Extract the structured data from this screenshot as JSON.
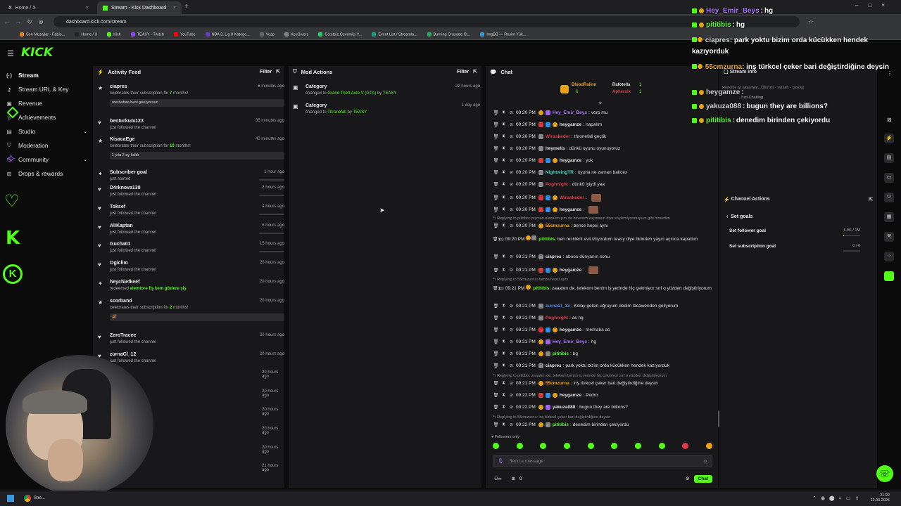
{
  "browser": {
    "tabs": [
      {
        "label": "Home / X"
      },
      {
        "label": "Stream - Kick Dashboard"
      }
    ],
    "url": "dashboard.kick.com/stream",
    "bookmarks": [
      "Son Mesajlar - Fabio...",
      "Home / X",
      "Kick",
      "TEASY - Twitch",
      "YouTube",
      "NBA 3. Lig 8 Katego...",
      "Vosp",
      "KeyGivers",
      "Ücretsiz Çevrimiçi Y...",
      "Event List / Streamla...",
      "Burning Crusade Cl...",
      "ImgBB — Resim Yük..."
    ]
  },
  "header": {
    "logo": "KICK"
  },
  "sidebar": {
    "items": [
      {
        "label": "Stream"
      },
      {
        "label": "Stream URL & Key"
      },
      {
        "label": "Revenue"
      },
      {
        "label": "Achievements"
      },
      {
        "label": "Studio"
      },
      {
        "label": "Moderation"
      },
      {
        "label": "Community"
      },
      {
        "label": "Drops & rewards"
      }
    ]
  },
  "activity_feed": {
    "title": "Activity Feed",
    "filter": "Filter",
    "items": [
      {
        "name": "ciapres",
        "desc_pre": "celebrates their subscription for ",
        "desc_hl": "7",
        "desc_post": " months!",
        "time": "6 minutes ago",
        "message": "merhabaa beni görüyorsun"
      },
      {
        "name": "benturkum123",
        "desc_pre": "just followed the channel",
        "desc_hl": "",
        "desc_post": "",
        "time": "35 minutes ago",
        "message": ""
      },
      {
        "name": "KisacaEge",
        "desc_pre": "celebrates their subscription for ",
        "desc_hl": "10",
        "desc_post": " months!",
        "time": "40 minutes ago",
        "message": "1 yıla 2 ay kaldı"
      },
      {
        "name": "Subscriber goal",
        "desc_pre": "just started",
        "desc_hl": "",
        "desc_post": "",
        "time": "1 hour ago",
        "message": ""
      },
      {
        "name": "D4rknova138",
        "desc_pre": "just followed the channel",
        "desc_hl": "",
        "desc_post": "",
        "time": "2 hours ago",
        "message": ""
      },
      {
        "name": "Toksef",
        "desc_pre": "just followed the channel",
        "desc_hl": "",
        "desc_post": "",
        "time": "4 hours ago",
        "message": ""
      },
      {
        "name": "AliKaptan",
        "desc_pre": "just followed the channel",
        "desc_hl": "",
        "desc_post": "",
        "time": "6 hours ago",
        "message": ""
      },
      {
        "name": "Gucha01",
        "desc_pre": "just followed the channel",
        "desc_hl": "",
        "desc_post": "",
        "time": "15 hours ago",
        "message": ""
      },
      {
        "name": "Ogiclim",
        "desc_pre": "just followed the channel",
        "desc_hl": "",
        "desc_post": "",
        "time": "20 hours ago",
        "message": ""
      },
      {
        "name": "heychiefkeef",
        "desc_pre": "redeemed ",
        "desc_hl": "elemtore fiş kem gözlere şiş",
        "desc_post": "",
        "time": "20 hours ago",
        "message": ""
      },
      {
        "name": "scorband",
        "desc_pre": "celebrates their subscription for ",
        "desc_hl": "2",
        "desc_post": " months!",
        "time": "20 hours ago",
        "message": "🎉"
      },
      {
        "name": "ZeroTracee",
        "desc_pre": "just followed the channel",
        "desc_hl": "",
        "desc_post": "",
        "time": "20 hours ago",
        "message": ""
      },
      {
        "name": "zurnaCl_12",
        "desc_pre": "just followed the channel",
        "desc_hl": "",
        "desc_post": "",
        "time": "20 hours ago",
        "message": ""
      }
    ],
    "extra_times": [
      "20 hours ago",
      "20 hours ago",
      "20 hours ago",
      "20 hours ago",
      "20 hours ago",
      "21 hours ago"
    ]
  },
  "mod_actions": {
    "title": "Mod Actions",
    "filter": "Filter",
    "items": [
      {
        "label": "Category",
        "pre": "changed to ",
        "value": "Grand Theft Auto V (GTA)",
        "by": " by ",
        "user": "TEASY",
        "time": "22 hours ago"
      },
      {
        "label": "Category",
        "pre": "changed to ",
        "value": "Thronefall",
        "by": " by ",
        "user": "TEASY",
        "time": "1 day ago"
      }
    ]
  },
  "chat": {
    "title": "Chat",
    "pinned": [
      {
        "user": "BloodRaiinn",
        "count": "6"
      },
      {
        "user": "Rafotella",
        "count": "1"
      },
      {
        "user": "Aphernix",
        "count": "1"
      }
    ],
    "messages": [
      {
        "time": "09:20 PM",
        "user": "Hey_Emir_Beys",
        "color": "#a970ff",
        "text": "vorp mu"
      },
      {
        "time": "09:20 PM",
        "user": "heygamze",
        "color": "#e0e0e0",
        "text": "napalım"
      },
      {
        "time": "09:20 PM",
        "user": "Wiraskeder",
        "color": "#e0394a",
        "text": "thronefall geçtik"
      },
      {
        "time": "09:20 PM",
        "user": "heymelis",
        "color": "#e0e0e0",
        "text": "dünkü oyunu oyunuyoruz"
      },
      {
        "time": "09:20 PM",
        "user": "heygamze",
        "color": "#e0e0e0",
        "text": "yok"
      },
      {
        "time": "09:20 PM",
        "user": "NightwingTR",
        "color": "#4fd1c5",
        "text": "oyuna ne zaman bakcez"
      },
      {
        "time": "09:20 PM",
        "user": "Poghnight",
        "color": "#e0394a",
        "text": "dünkü iyiydi yaa"
      },
      {
        "time": "09:20 PM",
        "user": "Wiraskeder",
        "color": "#e0394a",
        "text": ""
      },
      {
        "time": "09:20 PM",
        "user": "heygamze",
        "color": "#e0e0e0",
        "text": ""
      },
      {
        "time": "09:20 PM",
        "user": "55cmzurna",
        "color": "#e8a216",
        "text": "bence hepsi aynı",
        "reply": "Replying to pititibis: pişman olacakmışım da hevesim kaçmasın diye söylemiyormuşsun gibi hissettim"
      },
      {
        "time": "09:20 PM",
        "user": "pititibis",
        "color": "#53fc18",
        "text": "ben resident evil izliyordum teasy diye birinden yayın açınca kapattım"
      },
      {
        "time": "09:21 PM",
        "user": "ciapres",
        "color": "#e0e0e0",
        "text": "abooo dünyanın sonu"
      },
      {
        "time": "09:21 PM",
        "user": "heygamze",
        "color": "#e0e0e0",
        "text": ""
      },
      {
        "time": "09:21 PM",
        "user": "pititibis",
        "color": "#53fc18",
        "text": "zaaaten de, telekom benim iş yerinde hiç çekmiyor sırf o yüzden değiştiriyorum",
        "reply": "Replying to 55cmzurna: bence hepsi aynı"
      },
      {
        "time": "09:21 PM",
        "user": "zurnaCl_12",
        "color": "#4a90e2",
        "text": "Kolay gelsin uğruyum dedim lacawenden geliyorum"
      },
      {
        "time": "09:21 PM",
        "user": "Poghnight",
        "color": "#e0394a",
        "text": "as hg"
      },
      {
        "time": "09:21 PM",
        "user": "heygamze",
        "color": "#e0e0e0",
        "text": "merhaba as"
      },
      {
        "time": "09:21 PM",
        "user": "Hey_Emir_Beys",
        "color": "#a970ff",
        "text": "hg"
      },
      {
        "time": "09:21 PM",
        "user": "pititibis",
        "color": "#53fc18",
        "text": "hg"
      },
      {
        "time": "09:21 PM",
        "user": "ciapres",
        "color": "#e0e0e0",
        "text": "park yoktu bizim orda kücükken hendek kazıyorduk"
      },
      {
        "time": "09:21 PM",
        "user": "55cmzurna",
        "color": "#e8a216",
        "text": "inş türkcel çeker bari değiştirdiğine deysin",
        "reply": "Replying to pititibis: zaaaten de, telekom benim iş yerinde hiç çekmiyor sırf o yüzden değiştiriyorum"
      },
      {
        "time": "09:22 PM",
        "user": "heygamze",
        "color": "#e0e0e0",
        "text": "Pedro"
      },
      {
        "time": "09:22 PM",
        "user": "yakuza088",
        "color": "#e0e0e0",
        "text": "bugun they are billions?"
      },
      {
        "time": "09:22 PM",
        "user": "pititibis",
        "color": "#53fc18",
        "text": "denedim birinden çekiyordu",
        "reply": "Replying to 55cmzurna: inş türkcel çeker bari değiştirdiğine deysin"
      }
    ],
    "followers_only": "Followers only",
    "input_placeholder": "Send a message",
    "count": "0",
    "send": "Chat"
  },
  "overlay_chat": [
    {
      "user": "Hey_Emir_Beys",
      "text": "hg",
      "color": "#a970ff"
    },
    {
      "user": "pititibis",
      "text": "hg",
      "color": "#53fc18"
    },
    {
      "user": "ciapres",
      "text": "park yoktu bizim orda kücükken hendek kazıyorduk",
      "color": "#cfcfcf"
    },
    {
      "user": "55cmzurna",
      "text": "inş türkcel çeker bari değiştirdiğine deysin",
      "color": "#e8a216"
    },
    {
      "user": "heygamze",
      "text": "",
      "color": "#cfcfcf"
    },
    {
      "user": "yakuza088",
      "text": "bugun they are billions?",
      "color": "#cfcfcf"
    },
    {
      "user": "pititibis",
      "text": "denedim birinden çekiyordu",
      "color": "#53fc18"
    }
  ],
  "stream_info": {
    "title": "Stream info",
    "preview_text": "Herkese iyi akşamlar...Ölürüm - !wraith - !sosyal",
    "preview_sub": "Just Chatting"
  },
  "channel_actions": {
    "title": "Channel Actions",
    "back": "Set goals",
    "goals": [
      {
        "label": "Set follower goal",
        "value": "6.9K / 1M",
        "fraction": 0.0069
      },
      {
        "label": "Set subscription goal",
        "value": "0 / 6",
        "fraction": 0
      }
    ]
  },
  "taskbar": {
    "app": "Stre...",
    "clock_time": "21:22",
    "clock_date": "12.03.2026"
  },
  "colors": {
    "accent": "#53fc18",
    "panel": "#18181b",
    "bg": "#0b0b0c"
  }
}
